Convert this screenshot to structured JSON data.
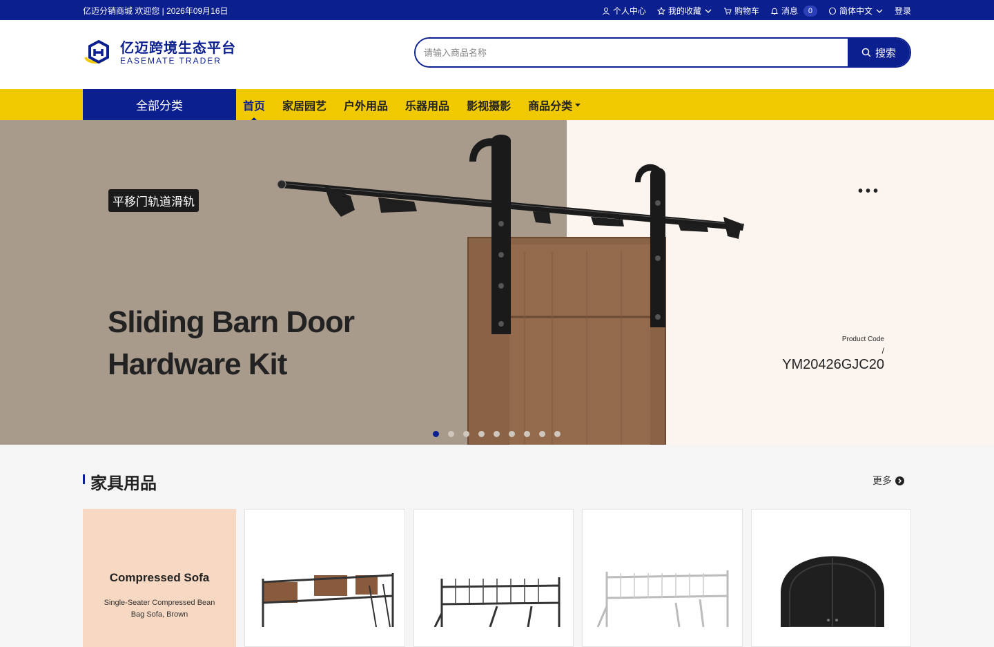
{
  "topbar": {
    "welcome": "亿迈分销商城 欢迎您 | 2026年09月16日",
    "personal_center": "个人中心",
    "favorites": "我的收藏",
    "cart": "购物车",
    "messages": "消息",
    "message_count": "0",
    "language": "简体中文",
    "login": "登录"
  },
  "header": {
    "logo_cn": "亿迈跨境生态平台",
    "logo_en": "EASEMATE TRADER",
    "search_placeholder": "请输入商品名称",
    "search_button": "搜索"
  },
  "nav": {
    "all_categories": "全部分类",
    "items": [
      "首页",
      "家居园艺",
      "户外用品",
      "乐器用品",
      "影视摄影",
      "商品分类"
    ]
  },
  "banner": {
    "tag": "平移门轨道滑轨",
    "title_line1": "Sliding Barn Door",
    "title_line2": "Hardware Kit",
    "product_code_label": "Product Code",
    "slash": "/",
    "product_code": "YM20426GJC20",
    "slide_count": 9,
    "active_slide": 1
  },
  "section": {
    "title": "家具用品",
    "more": "更多"
  },
  "cards": {
    "feature_title": "Compressed Sofa",
    "feature_subtitle": "Single-Seater Compressed Bean Bag Sofa, Brown"
  },
  "colors": {
    "brand_blue": "#0c1f8f",
    "nav_yellow": "#f1c900"
  }
}
